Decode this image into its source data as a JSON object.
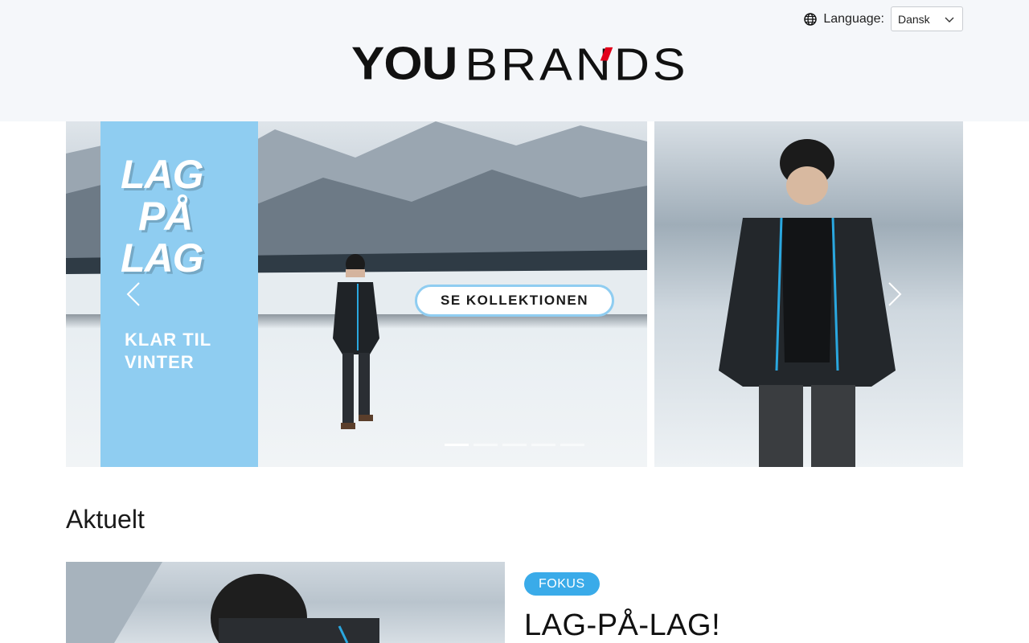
{
  "header": {
    "language_label": "Language:",
    "language_selected": "Dansk",
    "logo_part1": "YOU",
    "logo_part2": "BRANDS"
  },
  "hero": {
    "panel_title": [
      "LAG",
      "PÅ",
      "LAG"
    ],
    "panel_subtitle": [
      "KLAR TIL",
      "VINTER"
    ],
    "cta_label": "SE KOLLEKTIONEN",
    "slide_count": 5,
    "active_slide": 1,
    "accent_color": "#8fcdf1"
  },
  "news": {
    "section_title": "Aktuelt",
    "tag": "FOKUS",
    "title": "LAG-PÅ-LAG!",
    "tag_color": "#3aabe9"
  },
  "icons": [
    "globe-icon",
    "chevron-down-icon",
    "chevron-left-icon",
    "chevron-right-icon"
  ]
}
